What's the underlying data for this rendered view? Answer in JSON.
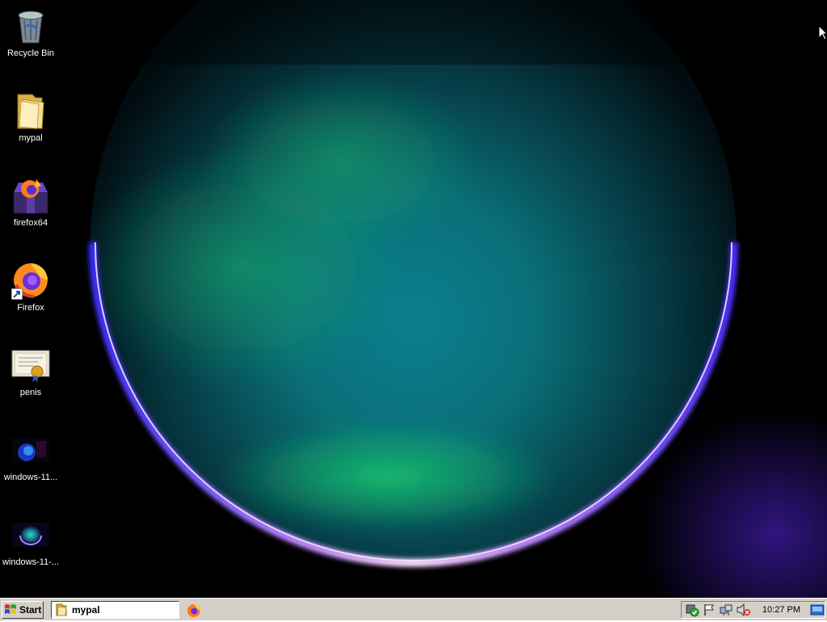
{
  "desktop": {
    "icons": [
      {
        "label": "Recycle Bin",
        "icon": "recycle-bin-icon"
      },
      {
        "label": "mypal",
        "icon": "folder-icon"
      },
      {
        "label": "firefox64",
        "icon": "firefox-installer-icon"
      },
      {
        "label": "Firefox",
        "icon": "firefox-icon",
        "shortcut": true
      },
      {
        "label": "penis",
        "icon": "certificate-icon"
      },
      {
        "label": "windows-11...",
        "icon": "image-file-icon"
      },
      {
        "label": "windows-11-...",
        "icon": "image-file-icon"
      }
    ],
    "wallpaper_colors": {
      "green": "#12c46a",
      "teal": "#0d8a9a",
      "purple": "#5a1fd6",
      "pink": "#f3a0ff",
      "bg": "#000000"
    }
  },
  "taskbar": {
    "start_label": "Start",
    "tasks": [
      {
        "label": "mypal",
        "icon": "folder-icon",
        "active": true
      }
    ],
    "quick_launch": [
      {
        "icon": "firefox-icon"
      }
    ],
    "tray": {
      "icons": [
        "security-shield-icon",
        "flag-icon",
        "network-icon",
        "volume-muted-icon"
      ],
      "clock": "10:27 PM",
      "desktop_icon": "show-desktop-icon"
    }
  }
}
